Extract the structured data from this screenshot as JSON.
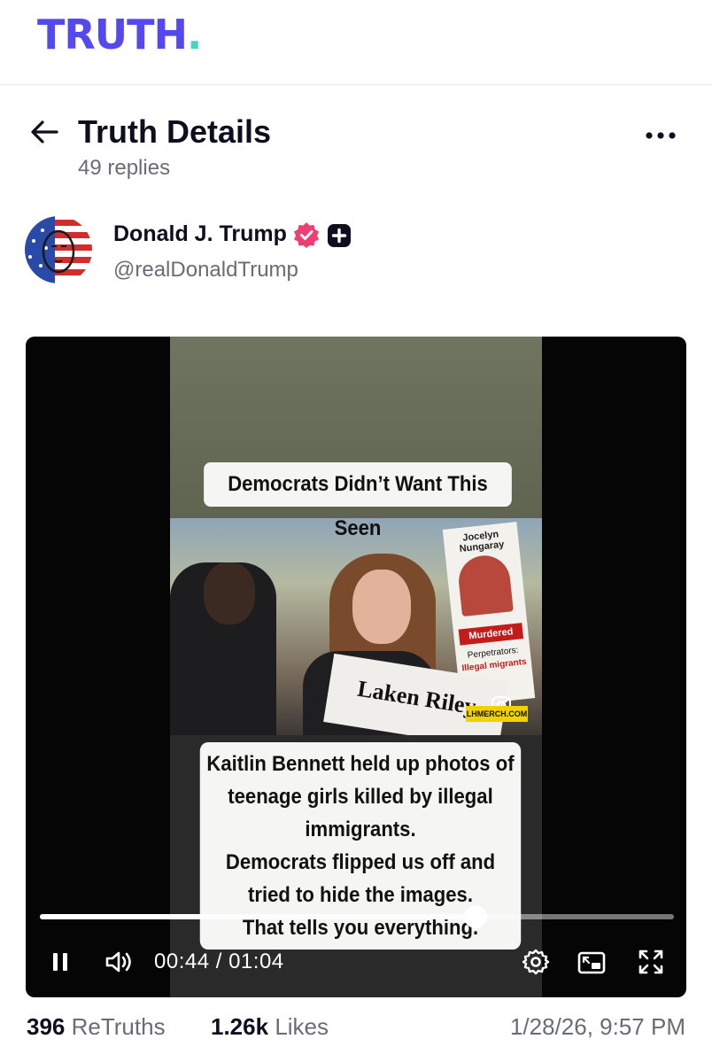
{
  "app": {
    "logo_text": "TRUTH",
    "logo_dot": ".",
    "colors": {
      "brand": "#5448ee",
      "brand_dot": "#3fd8c6",
      "verified": "#ef3f72"
    }
  },
  "header": {
    "back_icon": "arrow-left-icon",
    "title": "Truth Details",
    "replies": "49 replies",
    "more_icon": "more-horizontal-icon"
  },
  "author": {
    "name": "Donald J. Trump",
    "handle": "@realDonaldTrump",
    "badges": [
      "verified-icon",
      "plus-icon"
    ]
  },
  "video": {
    "caption_top": "Democrats Didn’t Want This Seen",
    "caption_bottom": [
      "Kaitlin Bennett held up photos of",
      "teenage girls killed by illegal",
      "immigrants.",
      "Democrats flipped us off and",
      "tried to hide the images.",
      "That tells you everything."
    ],
    "sign_text": "Laken Riley",
    "sign_jocelyn_name": "Jocelyn Nungaray",
    "sign_murdered": "Murdered",
    "sign_perp_1": "Perpetrators:",
    "sign_perp_2": "Illegal migrants",
    "watermark": "LHMERCH.COM",
    "current_time": "00:44",
    "duration": "01:04",
    "time_separator": " / ",
    "progress": 0.6875,
    "controls": [
      "pause-icon",
      "volume-icon",
      "settings-icon",
      "pip-icon",
      "fullscreen-icon"
    ]
  },
  "stats": {
    "retruths_count": "396",
    "retruths_label": "ReTruths",
    "likes_count": "1.26k",
    "likes_label": "Likes",
    "timestamp": "1/28/26, 9:57 PM"
  }
}
